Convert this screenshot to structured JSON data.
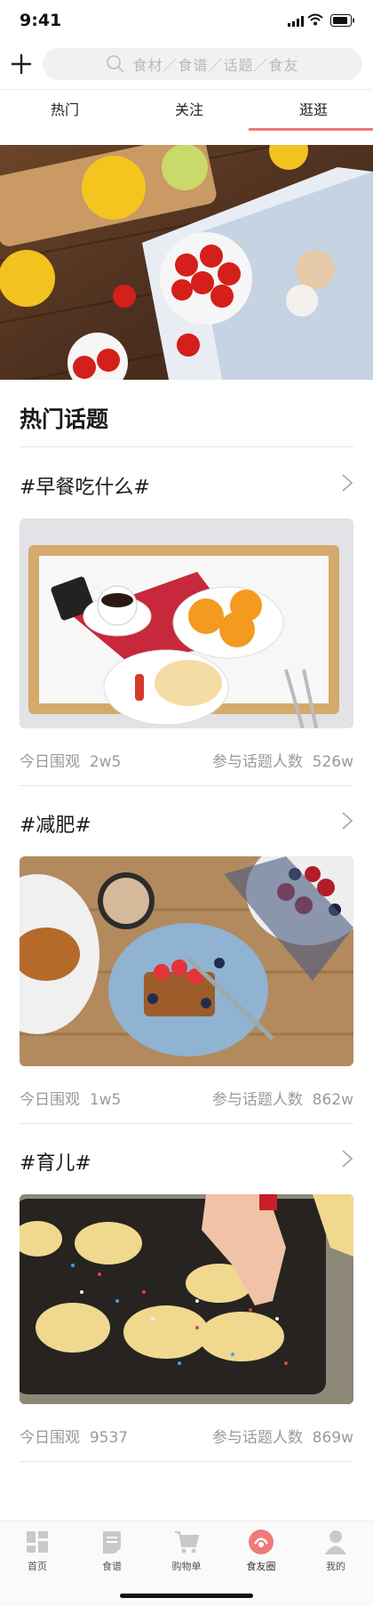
{
  "status_bar": {
    "time": "9:41"
  },
  "search": {
    "placeholder": "食材／食谱／话题／食友"
  },
  "tabs": [
    {
      "label": "热门"
    },
    {
      "label": "关注"
    },
    {
      "label": "逛逛",
      "active": true
    }
  ],
  "section": {
    "title": "热门话题"
  },
  "topics": [
    {
      "title": "#早餐吃什么#",
      "views_label": "今日围观",
      "views": "2w5",
      "participants_label": "参与话题人数",
      "participants": "526w"
    },
    {
      "title": "#减肥#",
      "views_label": "今日围观",
      "views": "1w5",
      "participants_label": "参与话题人数",
      "participants": "862w"
    },
    {
      "title": "#育儿#",
      "views_label": "今日围观",
      "views": "9537",
      "participants_label": "参与话题人数",
      "participants": "869w"
    }
  ],
  "bottom_nav": [
    {
      "label": "首页",
      "icon": "home-icon"
    },
    {
      "label": "食谱",
      "icon": "recipe-icon"
    },
    {
      "label": "购物单",
      "icon": "cart-icon"
    },
    {
      "label": "食友圈",
      "icon": "community-icon",
      "active": true
    },
    {
      "label": "我的",
      "icon": "profile-icon"
    }
  ],
  "colors": {
    "accent": "#f07a7a",
    "text_secondary": "#9a9a9a"
  }
}
